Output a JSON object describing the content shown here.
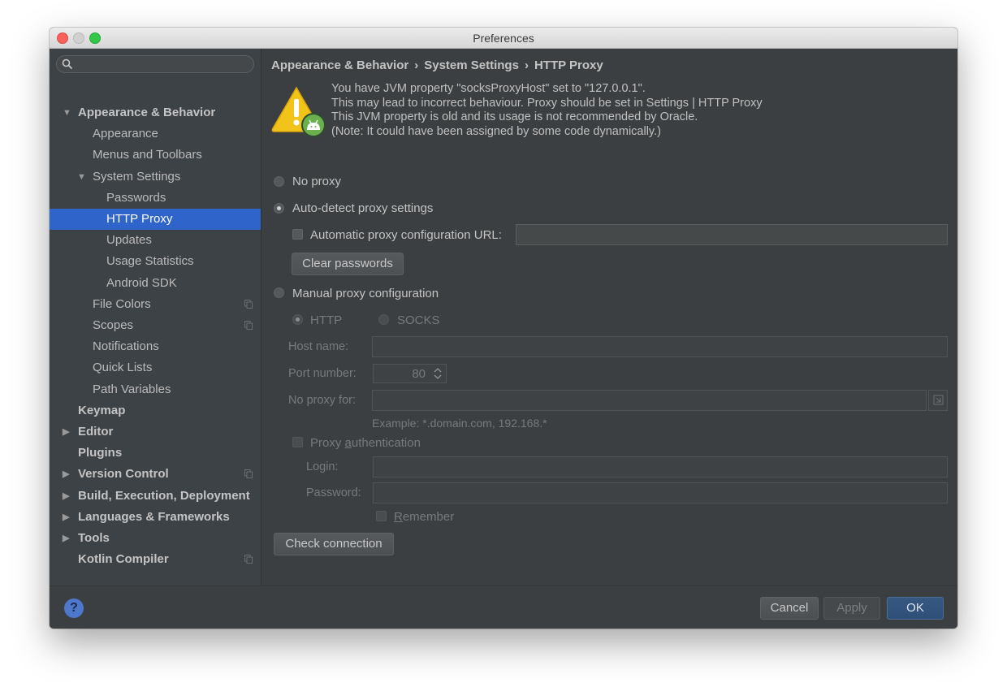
{
  "window": {
    "title": "Preferences"
  },
  "sidebar": {
    "items": [
      {
        "label": "Appearance & Behavior",
        "bold": true,
        "arrow": "▼",
        "indent": 0
      },
      {
        "label": "Appearance",
        "indent": 1
      },
      {
        "label": "Menus and Toolbars",
        "indent": 1
      },
      {
        "label": "System Settings",
        "arrow": "▼",
        "indent": 1
      },
      {
        "label": "Passwords",
        "indent": 2
      },
      {
        "label": "HTTP Proxy",
        "indent": 2,
        "selected": true
      },
      {
        "label": "Updates",
        "indent": 2
      },
      {
        "label": "Usage Statistics",
        "indent": 2
      },
      {
        "label": "Android SDK",
        "indent": 2
      },
      {
        "label": "File Colors",
        "indent": 1,
        "project_icon": true
      },
      {
        "label": "Scopes",
        "indent": 1,
        "project_icon": true
      },
      {
        "label": "Notifications",
        "indent": 1
      },
      {
        "label": "Quick Lists",
        "indent": 1
      },
      {
        "label": "Path Variables",
        "indent": 1
      },
      {
        "label": "Keymap",
        "bold": true,
        "indent": 0
      },
      {
        "label": "Editor",
        "bold": true,
        "arrow": "▶",
        "indent": 0
      },
      {
        "label": "Plugins",
        "bold": true,
        "indent": 0
      },
      {
        "label": "Version Control",
        "bold": true,
        "arrow": "▶",
        "indent": 0,
        "project_icon": true
      },
      {
        "label": "Build, Execution, Deployment",
        "bold": true,
        "arrow": "▶",
        "indent": 0
      },
      {
        "label": "Languages & Frameworks",
        "bold": true,
        "arrow": "▶",
        "indent": 0
      },
      {
        "label": "Tools",
        "bold": true,
        "arrow": "▶",
        "indent": 0
      },
      {
        "label": "Kotlin Compiler",
        "bold": true,
        "indent": 0,
        "project_icon": true
      }
    ]
  },
  "breadcrumb": {
    "part1": "Appearance & Behavior",
    "part2": "System Settings",
    "part3": "HTTP Proxy",
    "separator": "›"
  },
  "warning": {
    "line1": "You have JVM property \"socksProxyHost\" set to \"127.0.0.1\".",
    "line2": "This may lead to incorrect behaviour. Proxy should be set in Settings | HTTP Proxy",
    "line3": "This JVM property is old and its usage is not recommended by Oracle.",
    "line4": "(Note: It could have been assigned by some code dynamically.)"
  },
  "proxy": {
    "no_proxy_label": "No proxy",
    "auto_detect_label": "Auto-detect proxy settings",
    "auto_config_url_label": "Automatic proxy configuration URL:",
    "auto_config_url_value": "",
    "clear_passwords_label": "Clear passwords",
    "manual_label": "Manual proxy configuration",
    "http_label": "HTTP",
    "socks_label": "SOCKS",
    "host_name_label": "Host name:",
    "host_name_value": "",
    "port_number_label": "Port number:",
    "port_number_value": "80",
    "no_proxy_for_label": "No proxy for:",
    "no_proxy_for_value": "",
    "example_text": "Example: *.domain.com, 192.168.*",
    "proxy_auth_prefix": "Proxy ",
    "proxy_auth_mnemonic": "a",
    "proxy_auth_suffix": "uthentication",
    "login_label": "Login:",
    "login_value": "",
    "password_label": "Password:",
    "password_value": "",
    "remember_mnemonic": "R",
    "remember_suffix": "emember",
    "check_connection_label": "Check connection"
  },
  "footer": {
    "help": "?",
    "cancel": "Cancel",
    "apply": "Apply",
    "ok": "OK"
  },
  "colors": {
    "selection": "#2f65ca",
    "background": "#3c3f41",
    "sidebar": "#3d4247",
    "ok_button": "#365880"
  }
}
